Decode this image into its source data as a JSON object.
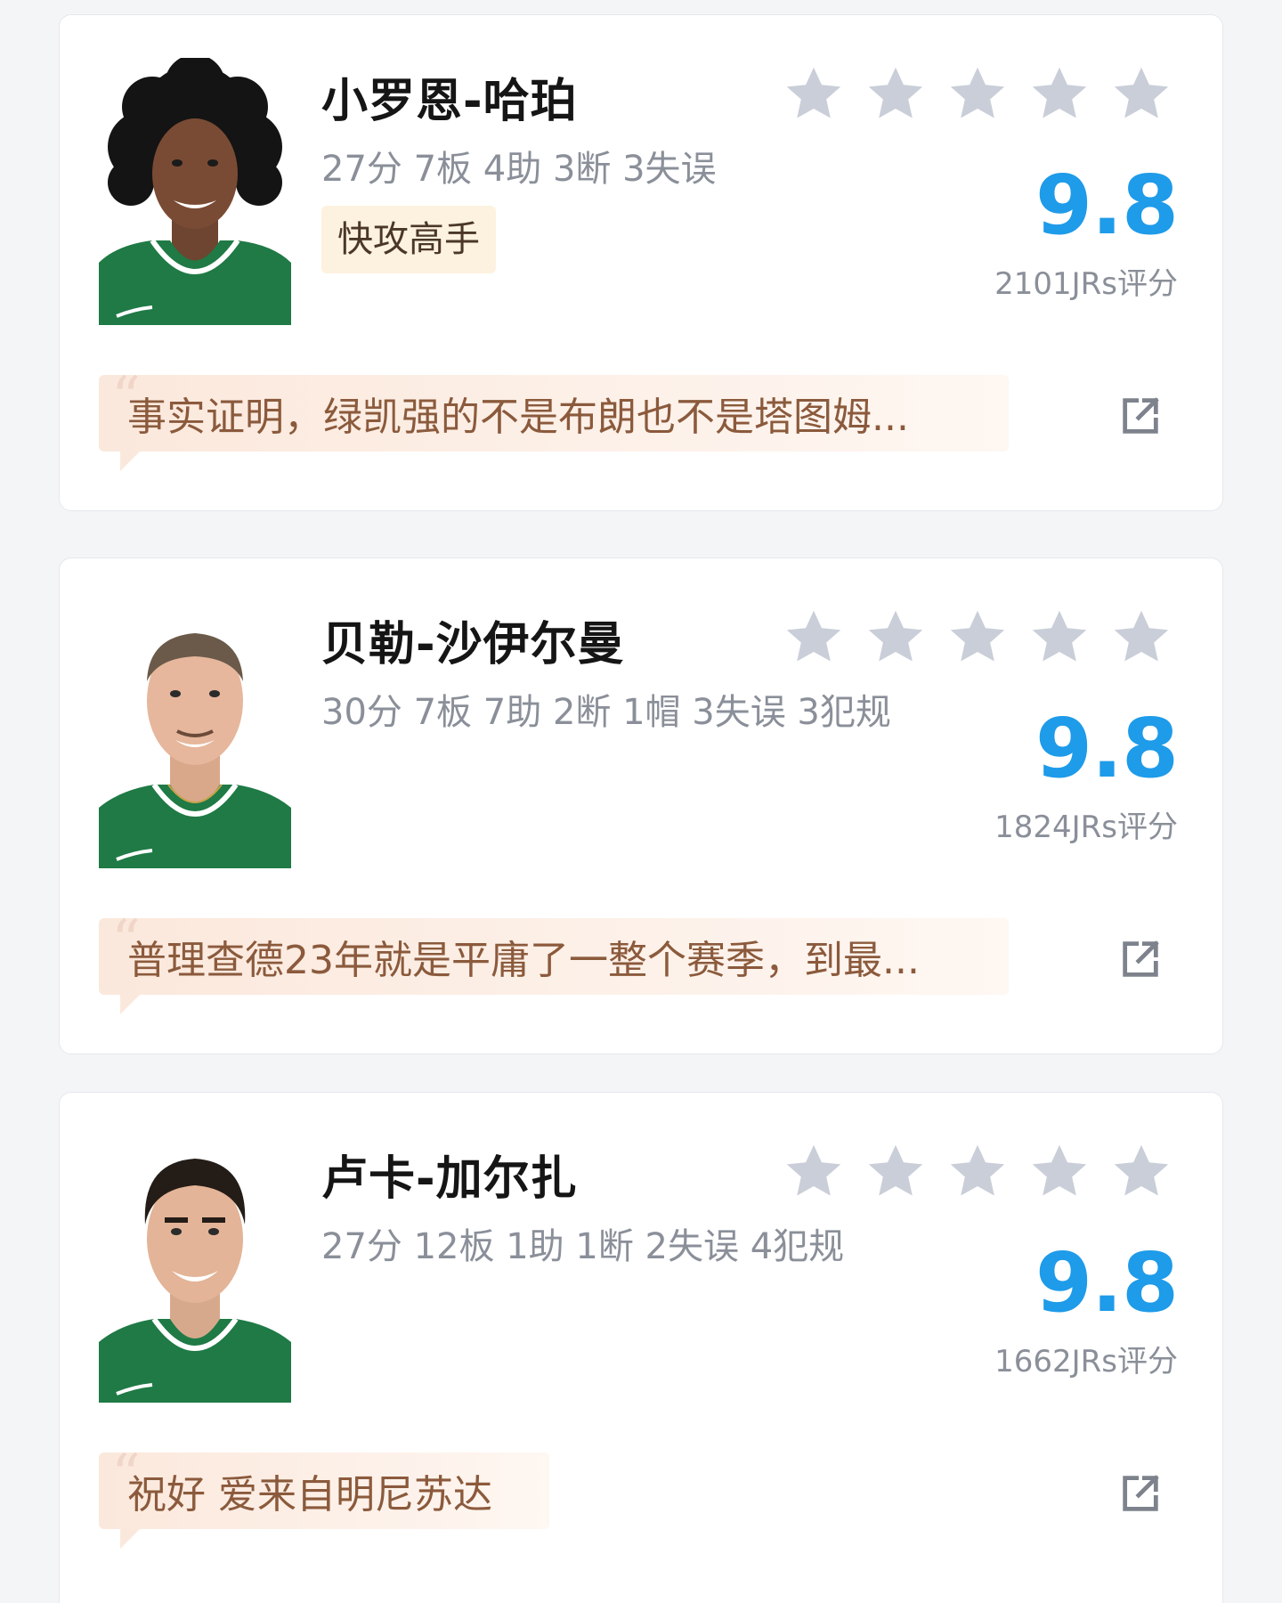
{
  "players": [
    {
      "name": "小罗恩-哈珀",
      "stats": "27分 7板 4助 3断 3失误",
      "tag": "快攻高手",
      "rating_stars": 5,
      "score": "9.8",
      "votes": "2101JRs评分",
      "comment": "事实证明，绿凯强的不是布朗也不是塔图姆...",
      "avatar_icon": "player-portrait-icon",
      "jersey_color": "#1f7a45"
    },
    {
      "name": "贝勒-沙伊尔曼",
      "stats": "30分 7板 7助 2断 1帽 3失误 3犯规",
      "tag": "",
      "rating_stars": 5,
      "score": "9.8",
      "votes": "1824JRs评分",
      "comment": "普理查德23年就是平庸了一整个赛季，到最...",
      "avatar_icon": "player-portrait-icon",
      "jersey_color": "#1f7a45"
    },
    {
      "name": "卢卡-加尔扎",
      "stats": "27分 12板 1助 1断 2失误 4犯规",
      "tag": "",
      "rating_stars": 5,
      "score": "9.8",
      "votes": "1662JRs评分",
      "comment": "祝好 爱来自明尼苏达",
      "avatar_icon": "player-portrait-icon",
      "jersey_color": "#1f7a45"
    }
  ],
  "colors": {
    "score": "#1e9be9",
    "star": "#c9ced8",
    "comment_text": "#8b5a3c",
    "tag_bg": "#fdf2df"
  },
  "icons": {
    "star": "star-icon",
    "share": "share-external-icon",
    "quote": "quote-icon"
  }
}
